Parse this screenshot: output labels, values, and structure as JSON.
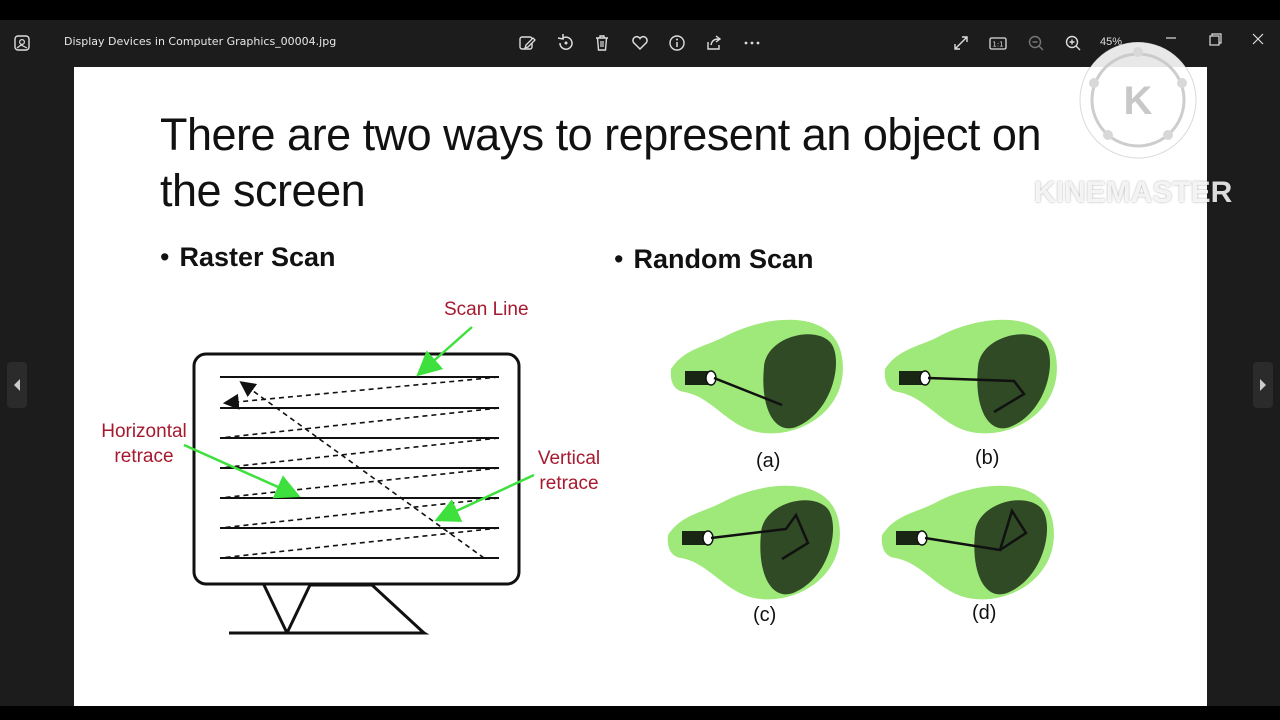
{
  "window": {
    "file_name": "Display Devices in Computer Graphics_00004.jpg",
    "zoom": "45%"
  },
  "toolbar": {
    "icons": [
      "edit-image-icon",
      "rotate-icon",
      "delete-icon",
      "favorite-icon",
      "info-icon",
      "share-icon",
      "more-icon"
    ],
    "view_icons": [
      "fullscreen-icon",
      "actual-size-icon",
      "zoom-out-icon",
      "zoom-in-icon"
    ]
  },
  "slide": {
    "title_line1": "There are two ways to represent an object on",
    "title_line2": "the screen",
    "bullet_raster": "Raster Scan",
    "bullet_random": "Random Scan",
    "labels": {
      "scan_line": "Scan Line",
      "horizontal_line1": "Horizontal",
      "horizontal_line2": "retrace",
      "vertical_line1": "Vertical",
      "vertical_line2": "retrace"
    },
    "subfig": [
      "(a)",
      "(b)",
      "(c)",
      "(d)"
    ]
  },
  "watermark": {
    "text": "KINEMASTER",
    "logo_letter": "K"
  },
  "colors": {
    "label_red": "#a6192e",
    "arrow_green": "#3de03d",
    "crt_light": "#9fe87a",
    "crt_dark": "#2f4a24"
  }
}
